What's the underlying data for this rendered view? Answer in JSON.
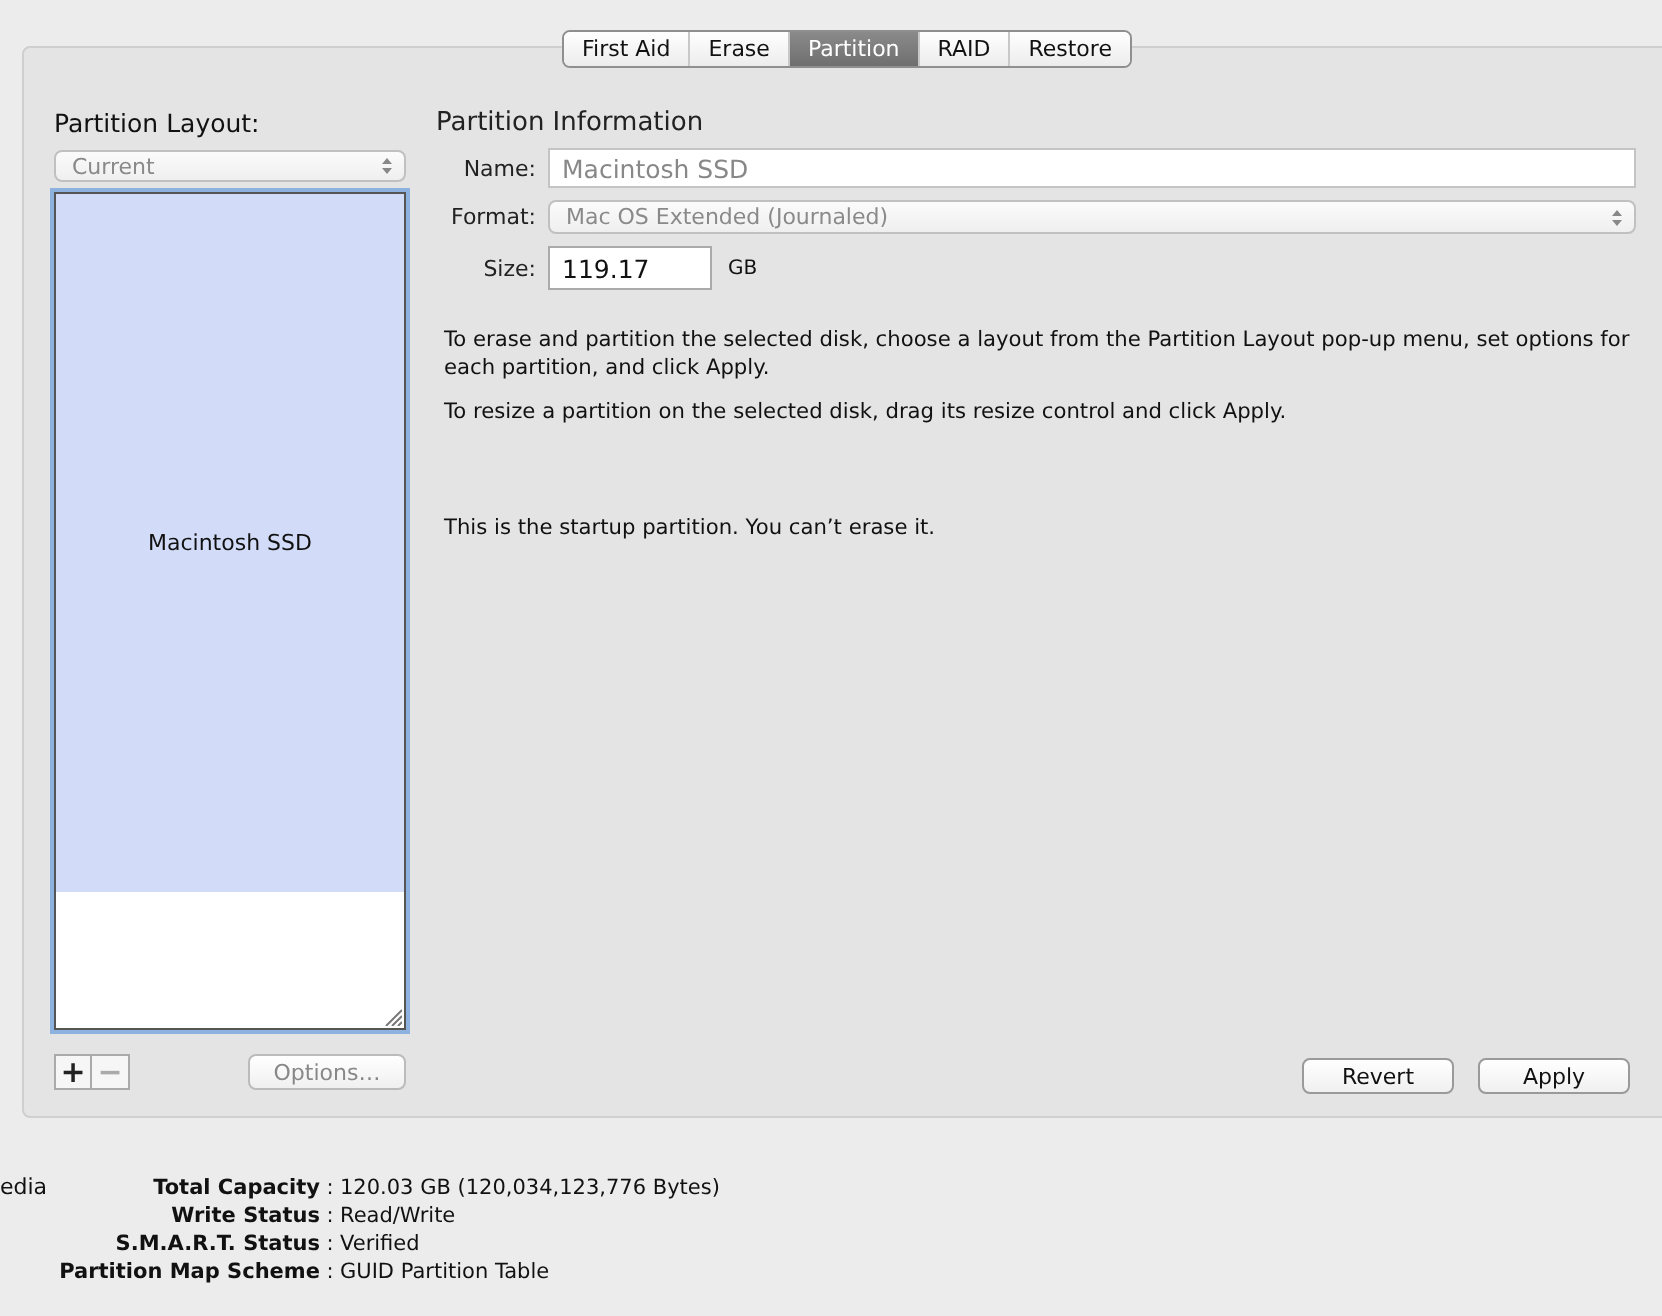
{
  "tabs": [
    {
      "label": "First Aid",
      "selected": false
    },
    {
      "label": "Erase",
      "selected": false
    },
    {
      "label": "Partition",
      "selected": true
    },
    {
      "label": "RAID",
      "selected": false
    },
    {
      "label": "Restore",
      "selected": false
    }
  ],
  "layout": {
    "title": "Partition Layout:",
    "popup": {
      "value": "Current",
      "disabled": true
    },
    "partitions": [
      {
        "name": "Macintosh SSD",
        "selected": true
      }
    ],
    "add_button": {
      "label": "+",
      "disabled": false
    },
    "remove_button": {
      "label": "−",
      "disabled": true
    },
    "options_button": {
      "label": "Options…",
      "disabled": true
    }
  },
  "info": {
    "title": "Partition Information",
    "name": {
      "label": "Name:",
      "value": "Macintosh SSD",
      "disabled": true
    },
    "format": {
      "label": "Format:",
      "value": "Mac OS Extended (Journaled)",
      "disabled": true
    },
    "size": {
      "label": "Size:",
      "value": "119.17",
      "unit": "GB"
    },
    "paragraphs": [
      "To erase and partition the selected disk, choose a layout from the Partition Layout pop-up menu, set options for each partition, and click Apply.",
      "To resize a partition on the selected disk, drag its resize control and click Apply.",
      "This is the startup partition. You can’t erase it."
    ]
  },
  "buttons": [
    "Revert",
    "Apply"
  ],
  "details": {
    "side_label": "edia",
    "rows": [
      {
        "label": "Total Capacity",
        "separator": ":",
        "value": "120.03 GB (120,034,123,776 Bytes)"
      },
      {
        "label": "Write Status",
        "separator": ":",
        "value": "Read/Write"
      },
      {
        "label": "S.M.A.R.T. Status",
        "separator": ":",
        "value": "Verified"
      },
      {
        "label": "Partition Map Scheme",
        "separator": ":",
        "value": "GUID Partition Table"
      }
    ]
  }
}
